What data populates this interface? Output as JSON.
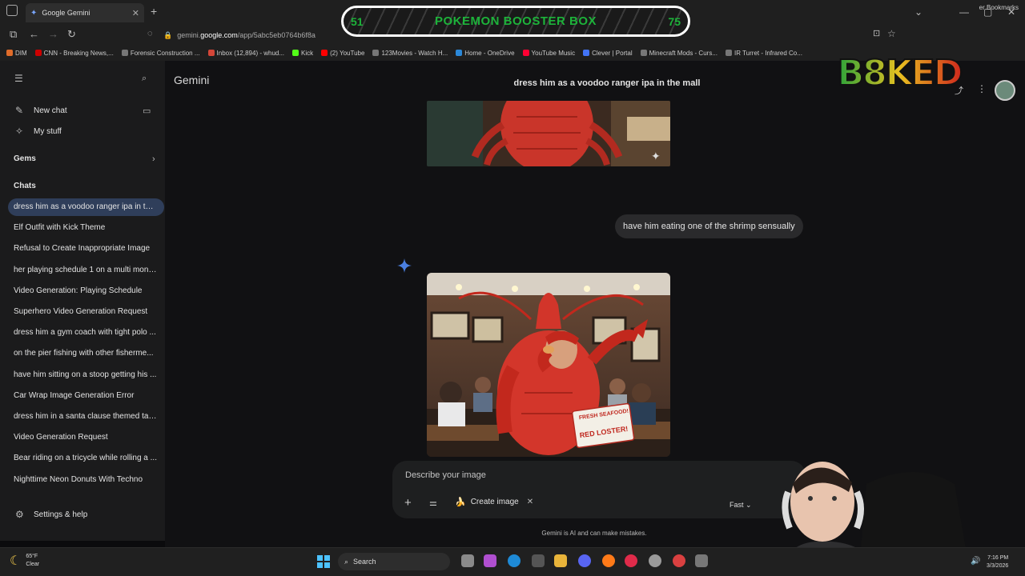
{
  "browser": {
    "tab_title": "Google Gemini",
    "url_prefix": "gemini.",
    "url_domain": "google.com",
    "url_path": "/app/5abc5eb0764b6f8a",
    "bookmarks": [
      {
        "label": "DIM",
        "color": "#e06c2a"
      },
      {
        "label": "CNN - Breaking News,...",
        "color": "#cc0000"
      },
      {
        "label": "Forensic Construction ...",
        "color": "#777777"
      },
      {
        "label": "Inbox (12,894) - whud...",
        "color": "#d44638"
      },
      {
        "label": "Kick",
        "color": "#53fc18"
      },
      {
        "label": "(2) YouTube",
        "color": "#ff0000"
      },
      {
        "label": "123Movies - Watch H...",
        "color": "#777777"
      },
      {
        "label": "Home - OneDrive",
        "color": "#2b88d8"
      },
      {
        "label": "YouTube Music",
        "color": "#ff0033"
      },
      {
        "label": "Clever | Portal",
        "color": "#4274f6"
      },
      {
        "label": "Minecraft Mods - Curs...",
        "color": "#777777"
      },
      {
        "label": "IR Turret - Infrared Co...",
        "color": "#777777"
      }
    ],
    "bookmarks_right": "er Bookmarks"
  },
  "overlay": {
    "left_number": "51",
    "title": "POKEMON BOOSTER BOX",
    "right_number": "75",
    "logo_text": "B8KED"
  },
  "sidebar": {
    "new_chat": "New chat",
    "my_stuff": "My stuff",
    "gems": "Gems",
    "chats_header": "Chats",
    "chats": [
      "dress him as a voodoo ranger ipa in the...",
      "Elf Outfit with Kick Theme",
      "Refusal to Create Inappropriate Image",
      "her playing schedule 1 on a multi monit...",
      "Video Generation: Playing Schedule",
      "Superhero Video Generation Request",
      "dress him a gym coach with tight polo ...",
      "on the pier fishing with other fisherme...",
      "have him sitting on a stoop getting his ...",
      "Car Wrap Image Generation Error",
      "dress him in a santa clause themed tan...",
      "Video Generation Request",
      "Bear riding on a tricycle while rolling a ...",
      "Nighttime Neon Donuts With Techno"
    ],
    "settings": "Settings & help"
  },
  "main": {
    "brand": "Gemini",
    "chat_title": "dress him as a voodoo ranger ipa in the mall",
    "user_message": "have him eating one of the shrimp sensually",
    "sign_line1": "FRESH SEAFOOD!",
    "sign_line2": "RED LOSTER!",
    "composer_placeholder": "Describe your image",
    "create_image_chip": "Create image",
    "mode": "Fast",
    "disclaimer": "Gemini is AI and can make mistakes."
  },
  "taskbar": {
    "temperature": "65°F",
    "condition": "Clear",
    "search": "Search",
    "time": "7:16 PM",
    "date": "3/3/2026"
  }
}
